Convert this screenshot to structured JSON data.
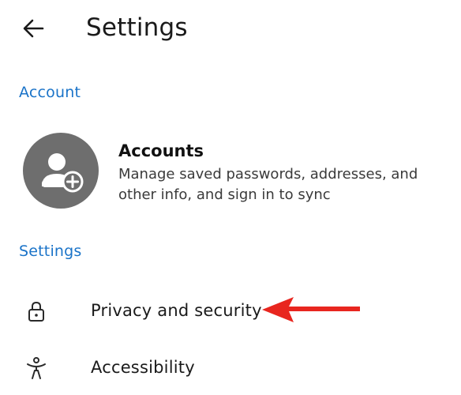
{
  "header": {
    "title": "Settings",
    "back_icon": "arrow-left-icon"
  },
  "sections": {
    "account": {
      "label": "Account"
    },
    "settings": {
      "label": "Settings"
    }
  },
  "accounts_item": {
    "title": "Accounts",
    "description": "Manage saved passwords, addresses, and other info, and sign in to sync",
    "icon": "add-person-icon"
  },
  "settings_items": [
    {
      "label": "Privacy and security",
      "icon": "lock-icon"
    },
    {
      "label": "Accessibility",
      "icon": "accessibility-icon"
    }
  ],
  "colors": {
    "accent": "#1a73c8",
    "avatar_bg": "#6e6e6e",
    "annotation": "#e8261f"
  }
}
